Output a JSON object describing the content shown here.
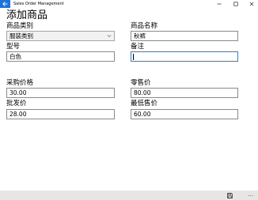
{
  "window": {
    "title": "Sales Order Management",
    "controls": {
      "minimize": "—",
      "maximize": "☐",
      "close": "✕"
    }
  },
  "page": {
    "title": "添加商品"
  },
  "form": {
    "category": {
      "label": "商品类别",
      "value": "服装类别"
    },
    "name": {
      "label": "商品名称",
      "value": "秋裤"
    },
    "model": {
      "label": "型号",
      "value": "白色"
    },
    "remark": {
      "label": "备注",
      "value": ""
    },
    "purchase_price": {
      "label": "采购价格",
      "value": "30.00"
    },
    "retail_price": {
      "label": "零售价",
      "value": "80.00"
    },
    "wholesale_price": {
      "label": "批发价",
      "value": "28.00"
    },
    "min_price": {
      "label": "最低售价",
      "value": "60.00"
    }
  },
  "appbar": {
    "more": "..."
  }
}
